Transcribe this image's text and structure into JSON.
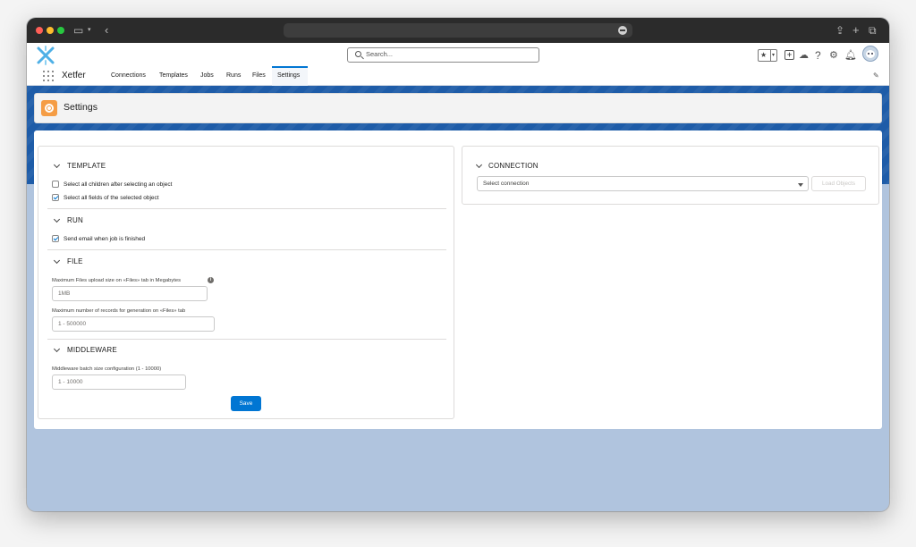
{
  "browser": {
    "icons": [
      "close-dot",
      "minimize-dot",
      "zoom-dot",
      "sidebar-icon",
      "back-icon",
      "share-icon",
      "new-tab-icon",
      "tabs-overview-icon"
    ],
    "colors": {
      "close": "#ff5f57",
      "minimize": "#febc2e",
      "zoom": "#28c840"
    }
  },
  "header": {
    "search_placeholder": "Search...",
    "app_name": "Xetfer",
    "tabs": [
      {
        "label": "Connections"
      },
      {
        "label": "Templates"
      },
      {
        "label": "Jobs"
      },
      {
        "label": "Runs"
      },
      {
        "label": "Files"
      },
      {
        "label": "Settings",
        "active": true
      }
    ],
    "utility_icons": [
      "favorites-star-icon",
      "global-actions-plus-icon",
      "trailhead-icon",
      "help-icon",
      "setup-gear-icon",
      "notifications-bell-icon",
      "avatar"
    ],
    "accent_color": "#0176d3"
  },
  "page": {
    "title": "Settings",
    "icon": "settings-gear-icon",
    "icon_color": "#f59d45"
  },
  "settings": {
    "template": {
      "heading": "TEMPLATE",
      "options": [
        {
          "label": "Select all children after selecting an object",
          "checked": false
        },
        {
          "label": "Select all fields of the selected object",
          "checked": true
        }
      ]
    },
    "run": {
      "heading": "RUN",
      "options": [
        {
          "label": "Send email when job is finished",
          "checked": true
        }
      ]
    },
    "file": {
      "heading": "FILE",
      "upload_label": "Maximum Files upload size on «Files» tab in Megabytes",
      "upload_value": "1MB",
      "records_label": "Maximum number of records for generation on «Files» tab",
      "records_placeholder": "1 - 500000"
    },
    "middleware": {
      "heading": "MIDDLEWARE",
      "batch_label": "Middleware batch size configuration (1 - 10000)",
      "batch_placeholder": "1 - 10000"
    },
    "save_label": "Save"
  },
  "connection": {
    "heading": "CONNECTION",
    "select_placeholder": "Select connection",
    "load_label": "Load Objects"
  }
}
